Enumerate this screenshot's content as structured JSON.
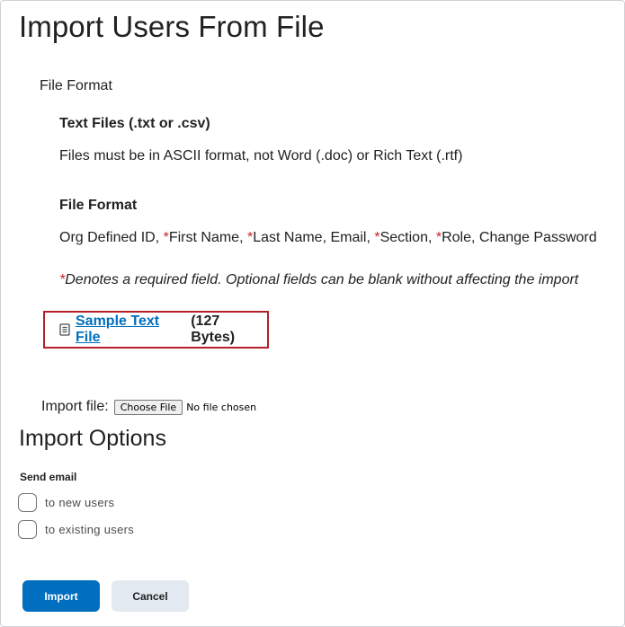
{
  "page": {
    "title": "Import Users From File"
  },
  "file_format_section": {
    "label": "File Format",
    "text_files_heading": "Text Files (.txt or .csv)",
    "text_files_desc": "Files must be in ASCII format, not Word (.doc) or Rich Text (.rtf)",
    "format_heading": "File Format",
    "fields": {
      "org_id": "Org Defined ID, ",
      "first_name": "First Name, ",
      "last_name": "Last Name, Email, ",
      "section": "Section, ",
      "role": "Role, Change Password",
      "required_marker": "*"
    },
    "required_note": "Denotes a required field. Optional fields can be blank without affecting the import"
  },
  "sample": {
    "link_text": "Sample Text File",
    "size_text": "(127 Bytes)",
    "icon": "document-icon"
  },
  "import_file": {
    "label": "Import file:",
    "button_label": "Choose File",
    "status": "No file chosen"
  },
  "import_options": {
    "title": "Import Options",
    "send_email_label": "Send email",
    "checkboxes": [
      {
        "label": "to new users",
        "checked": false
      },
      {
        "label": "to existing users",
        "checked": false
      }
    ]
  },
  "actions": {
    "import_label": "Import",
    "cancel_label": "Cancel"
  },
  "colors": {
    "primary": "#006fbf",
    "required": "#cd2026",
    "highlight_border": "#b3212b",
    "secondary_bg": "#e3e9f1"
  }
}
